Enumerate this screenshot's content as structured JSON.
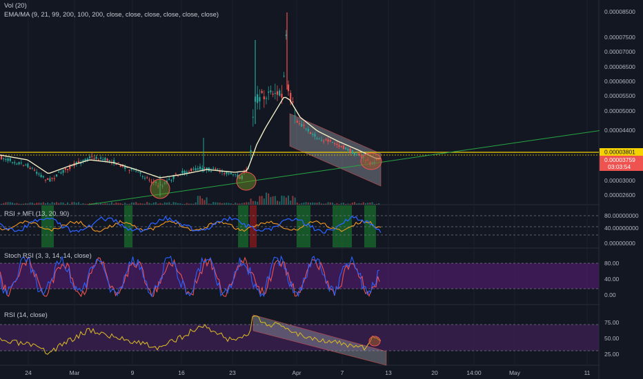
{
  "main_pane": {
    "legend_vol": "Vol (20)",
    "legend_ma": "EMA/MA (9, 21, 99, 200, 100, 200, close, close, close, close, close, close)",
    "y_ticks": [
      "0.00008500",
      "0.00007500",
      "0.00007000",
      "0.00006500",
      "0.00006000",
      "0.00005500",
      "0.00005000",
      "0.00004400",
      "0.00003000",
      "0.00002600"
    ],
    "price_label": "0.00003801",
    "price_label_2": "0.00003759",
    "countdown": "03:03:54"
  },
  "rsi_mfi_pane": {
    "legend": "RSI + MFI (13, 20, 90)",
    "y_ticks": [
      "80.00000000",
      "40.00000000",
      "0.00000000"
    ]
  },
  "stoch_pane": {
    "legend": "Stoch RSI (3, 3, 14, 14, close)",
    "y_ticks": [
      "80.00",
      "40.00",
      "0.00"
    ]
  },
  "rsi_pane": {
    "legend": "RSI (14, close)",
    "y_ticks": [
      "75.00",
      "50.00",
      "25.00"
    ]
  },
  "x_axis": {
    "labels": [
      "24",
      "Mar",
      "9",
      "16",
      "23",
      "Apr",
      "7",
      "13",
      "20",
      "14:00",
      "May",
      "11"
    ]
  },
  "colors": {
    "background": "#131722",
    "up": "#26a69a",
    "down": "#ef5350",
    "ma_line": "#f5efc8",
    "trendline": "#27a844",
    "support_line": "#f5d300",
    "rsi_line": "#2962ff",
    "mfi_line": "#f59a23",
    "stoch_k": "#2962ff",
    "stoch_d": "#ef5350",
    "stoch_band": "#4a1c66",
    "rsi14_line": "#d6b428",
    "rsi_band": "#3a1f4f"
  },
  "chart_data": [
    {
      "type": "candlestick",
      "title": "EMA/MA (9, 21, 99, 200, 100, 200, close, close, close, close, close, close)",
      "ylim": [
        2.4e-06,
        8.6e-06
      ],
      "x_ticks": [
        "24",
        "Mar",
        "9",
        "16",
        "23",
        "Apr",
        "7",
        "13",
        "20",
        "14:00",
        "May",
        "11"
      ],
      "highlighted_levels": [
        3.801e-05
      ],
      "close_path": [
        {
          "x": "24",
          "close": 3.7e-06
        },
        {
          "x": "Mar",
          "close": 3.5e-06
        },
        {
          "x": "9",
          "close": 3.1e-06
        },
        {
          "x": "16",
          "close": 3.3e-06
        },
        {
          "x": "23",
          "close": 3.3e-06
        },
        {
          "x": "Apr",
          "close": 5e-06
        },
        {
          "x": "7",
          "close": 4.2e-06
        },
        {
          "x": "13",
          "close": 3.8e-06
        }
      ]
    },
    {
      "type": "line",
      "title": "RSI + MFI (13, 20, 90)",
      "ylim": [
        0,
        100
      ],
      "y_ticks": [
        0,
        40,
        80
      ]
    },
    {
      "type": "line",
      "title": "Stoch RSI (3, 3, 14, 14, close)",
      "ylim": [
        0,
        100
      ],
      "y_ticks": [
        0,
        40,
        80
      ],
      "band": [
        20,
        80
      ]
    },
    {
      "type": "line",
      "title": "RSI (14, close)",
      "ylim": [
        0,
        100
      ],
      "y_ticks": [
        25,
        50,
        75
      ],
      "band": [
        30,
        70
      ]
    }
  ]
}
